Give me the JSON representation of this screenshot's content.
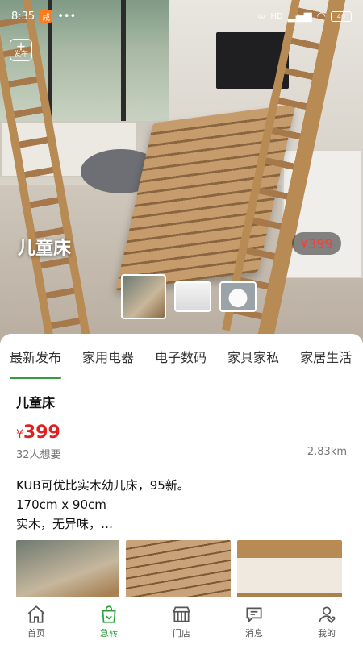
{
  "status_bar": {
    "time": "8:35",
    "app_badge": "咸",
    "signal": "HD",
    "battery": "40"
  },
  "hero": {
    "publish_label": "发布",
    "title": "儿童床",
    "price": "¥399"
  },
  "tabs": [
    {
      "label": "最新发布",
      "active": true
    },
    {
      "label": "家用电器"
    },
    {
      "label": "电子数码"
    },
    {
      "label": "家具家私"
    },
    {
      "label": "家居生活"
    }
  ],
  "item": {
    "title": "儿童床",
    "price_symbol": "¥",
    "price_value": "399",
    "wants": "32人想要",
    "distance": "2.83km",
    "desc_line1": "KUB可优比实木幼儿床，95新。",
    "desc_line2": "170cm x 90cm",
    "desc_line3": "实木，无异味，…"
  },
  "bottom_nav": [
    {
      "label": "首页",
      "icon": "home-icon"
    },
    {
      "label": "急转",
      "icon": "bag-icon",
      "active": true
    },
    {
      "label": "门店",
      "icon": "store-icon"
    },
    {
      "label": "消息",
      "icon": "message-icon"
    },
    {
      "label": "我的",
      "icon": "profile-icon"
    }
  ],
  "colors": {
    "accent": "#2e9e3f",
    "price": "#e02020"
  }
}
